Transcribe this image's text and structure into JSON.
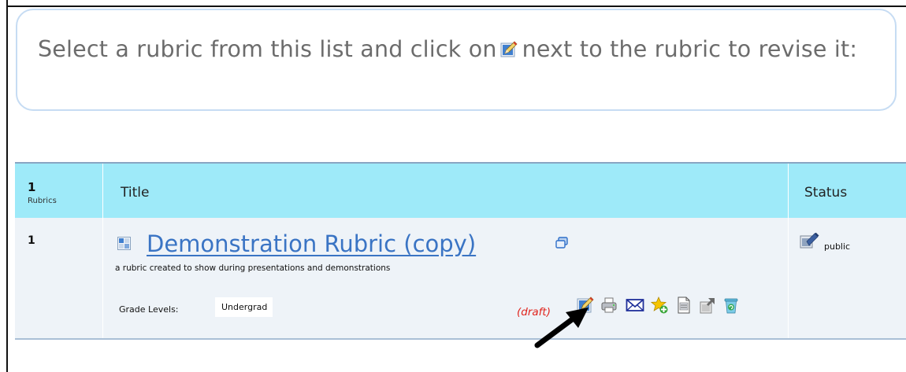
{
  "instruction": {
    "before_icon": "Select a rubric from this list and click on",
    "after_icon": "next to the rubric to revise it:",
    "icon": "edit-pencil-icon"
  },
  "table": {
    "headers": {
      "count": "1",
      "count_label": "Rubrics",
      "title": "Title",
      "status": "Status"
    },
    "rows": [
      {
        "index": "1",
        "title": "Demonstration Rubric (copy)",
        "description": "a rubric created to show during presentations and demonstrations",
        "grade_levels_label": "Grade Levels:",
        "grade_levels_value": "Undergrad",
        "draft_label": "(draft)",
        "status": "public",
        "actions": [
          "edit-icon",
          "print-icon",
          "email-icon",
          "favorite-add-icon",
          "document-icon",
          "export-icon",
          "delete-icon"
        ]
      }
    ]
  },
  "colors": {
    "header_bg": "#9eeaf9",
    "row_bg": "#eef3f8",
    "link": "#3a74c4",
    "draft": "#e0231c",
    "instruction_text": "#6c6c6c",
    "instruction_border": "#c6dcf3"
  }
}
